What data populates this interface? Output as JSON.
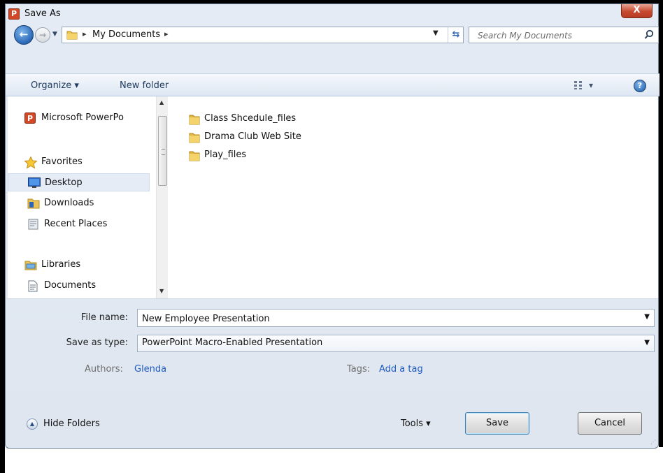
{
  "window": {
    "title": "Save As",
    "app_icon_letter": "P",
    "close_label": "X"
  },
  "nav": {
    "back_label": "←",
    "forward_label": "→",
    "address_breadcrumb_sep": "▸",
    "address_location": "My Documents",
    "search_placeholder": "Search My Documents"
  },
  "toolbar": {
    "organize_label": "Organize ▾",
    "new_folder_label": "New folder",
    "views_label": "▾",
    "help_label": "?"
  },
  "sidebar": {
    "items": [
      {
        "label": "Microsoft PowerPo",
        "icon": "powerpoint-icon"
      },
      {
        "label": "Favorites",
        "icon": "star-icon"
      },
      {
        "label": "Desktop",
        "icon": "desktop-icon",
        "selected": true
      },
      {
        "label": "Downloads",
        "icon": "downloads-folder-icon"
      },
      {
        "label": "Recent Places",
        "icon": "recent-places-icon"
      },
      {
        "label": "Libraries",
        "icon": "libraries-icon"
      },
      {
        "label": "Documents",
        "icon": "document-icon"
      }
    ]
  },
  "files": [
    {
      "name": "Class Shcedule_files",
      "icon": "folder-icon"
    },
    {
      "name": "Drama Club Web Site",
      "icon": "folder-icon"
    },
    {
      "name": "Play_files",
      "icon": "folder-icon"
    }
  ],
  "form": {
    "file_name_label": "File name:",
    "file_name_value": "New Employee Presentation",
    "save_as_type_label": "Save as type:",
    "save_as_type_value": "PowerPoint Macro-Enabled Presentation",
    "authors_label": "Authors:",
    "authors_value": "Glenda",
    "tags_label": "Tags:",
    "tags_value": "Add a tag"
  },
  "footer": {
    "hide_folders_label": "Hide Folders",
    "tools_label": "Tools   ▾",
    "save_label": "Save",
    "cancel_label": "Cancel"
  },
  "colors": {
    "accent": "#1e5bbf",
    "toolbar_text": "#1e3b5e",
    "close_button": "#c74a30"
  }
}
